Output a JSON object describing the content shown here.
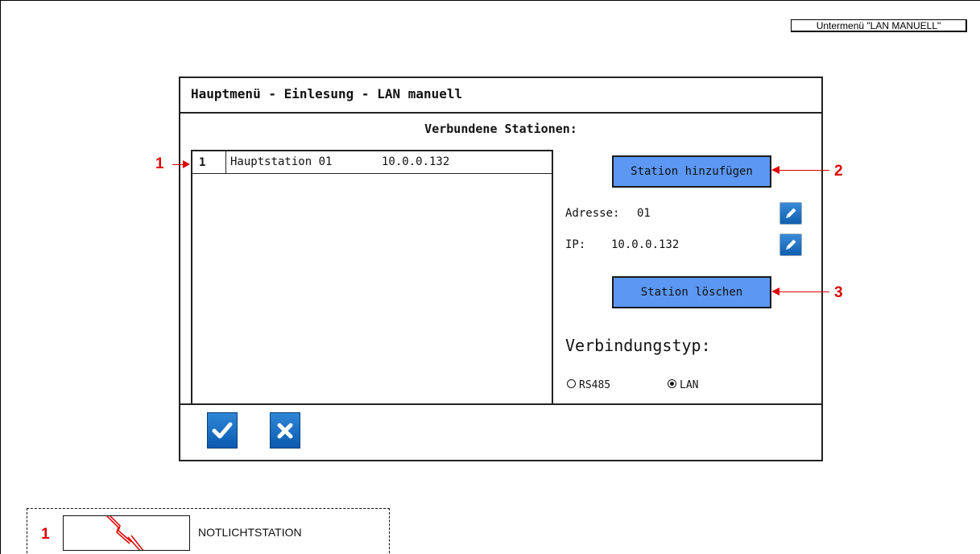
{
  "submenu_tag": "Untermenü \"LAN MANUELL\"",
  "screen": {
    "title": "Hauptmenü - Einlesung - LAN manuell",
    "list_heading": "Verbundene Stationen:",
    "stations": [
      {
        "number": "1",
        "name": "Hauptstation 01",
        "ip": "10.0.0.132"
      }
    ],
    "add_button": "Station hinzufügen",
    "address_label": "Adresse:",
    "address_value": "01",
    "ip_label": "IP:",
    "ip_value": "10.0.0.132",
    "delete_button": "Station löschen",
    "connection_type_label": "Verbindungstyp:",
    "connection_options": [
      {
        "label": "RS485",
        "selected": false
      },
      {
        "label": "LAN",
        "selected": true
      }
    ],
    "accent_color": "#5b97f3"
  },
  "callouts": [
    {
      "number": "1"
    },
    {
      "number": "2"
    },
    {
      "number": "3"
    }
  ],
  "legend": {
    "number": "1",
    "label": "NOTLICHTSTATION"
  },
  "icons": {
    "confirm": "checkmark-icon",
    "cancel": "close-icon",
    "edit": "pencil-icon",
    "legend_symbol": "lightning-icon"
  }
}
